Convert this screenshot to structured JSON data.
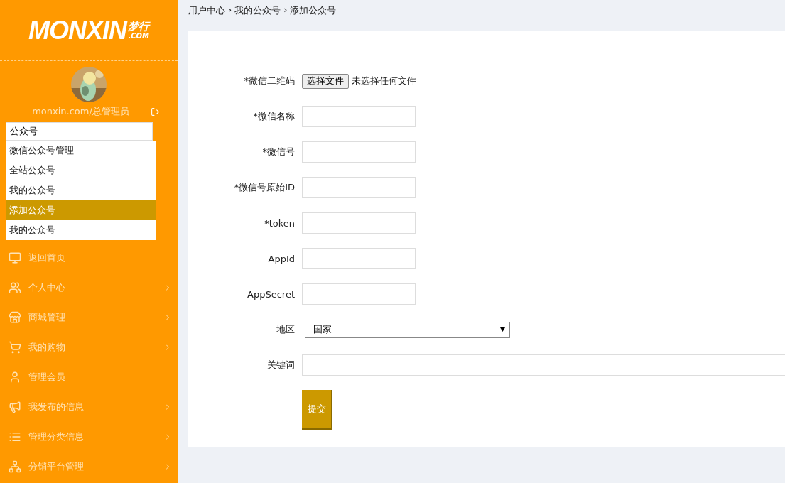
{
  "sidebar": {
    "logo": {
      "main": "MONXIN",
      "cn": "梦行",
      "domain": ".COM"
    },
    "user": {
      "name": "monxin.com/总管理员"
    },
    "search": {
      "value": "公众号",
      "suggestions": [
        {
          "label": "微信公众号管理",
          "selected": false
        },
        {
          "label": "全站公众号",
          "selected": false
        },
        {
          "label": "我的公众号",
          "selected": false
        },
        {
          "label": "添加公众号",
          "selected": true
        },
        {
          "label": "我的公众号",
          "selected": false
        }
      ]
    },
    "menu": [
      {
        "kind": "monitor",
        "label": "返回首页",
        "has_submenu": false
      },
      {
        "kind": "users",
        "label": "个人中心",
        "has_submenu": true
      },
      {
        "kind": "store",
        "label": "商城管理",
        "has_submenu": true
      },
      {
        "kind": "cart",
        "label": "我的购物",
        "has_submenu": true
      },
      {
        "kind": "user",
        "label": "管理会员",
        "has_submenu": false
      },
      {
        "kind": "megaphone",
        "label": "我发布的信息",
        "has_submenu": true
      },
      {
        "kind": "list",
        "label": "管理分类信息",
        "has_submenu": true
      },
      {
        "kind": "sitemap",
        "label": "分销平台管理",
        "has_submenu": true
      }
    ]
  },
  "breadcrumb": {
    "separator": "›",
    "items": [
      "用户中心",
      "我的公众号",
      "添加公众号"
    ]
  },
  "form": {
    "fields": [
      {
        "kind": "file",
        "label": "*微信二维码",
        "button": "选择文件",
        "status": "未选择任何文件"
      },
      {
        "kind": "text",
        "label": "*微信名称"
      },
      {
        "kind": "text",
        "label": "*微信号"
      },
      {
        "kind": "text",
        "label": "*微信号原始ID"
      },
      {
        "kind": "text",
        "label": "*token"
      },
      {
        "kind": "text",
        "label": "AppId"
      },
      {
        "kind": "text",
        "label": "AppSecret"
      },
      {
        "kind": "select",
        "label": "地区",
        "value": "-国家-"
      },
      {
        "kind": "wide",
        "label": "关键词"
      }
    ],
    "submit": "提交"
  }
}
